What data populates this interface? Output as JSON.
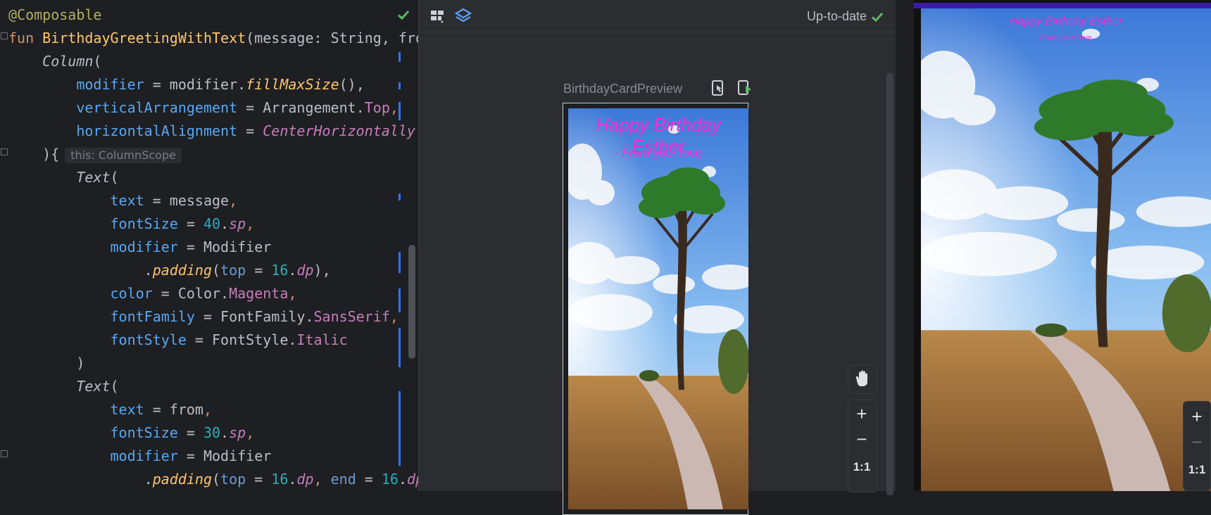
{
  "editor": {
    "hint_text": "this: ColumnScope",
    "lines": [
      [
        {
          "t": "@Composable",
          "c": "ann"
        }
      ],
      [
        {
          "t": "fun ",
          "c": "kw"
        },
        {
          "t": "BirthdayGreetingWithText",
          "c": "fn"
        },
        {
          "t": "(message: String, fro",
          "c": "id"
        }
      ],
      [
        {
          "t": "    ",
          "c": "id"
        },
        {
          "t": "Column",
          "c": "it"
        },
        {
          "t": "(",
          "c": "id"
        }
      ],
      [
        {
          "t": "        ",
          "c": "id"
        },
        {
          "t": "modifier",
          "c": "prm"
        },
        {
          "t": " = modifier.",
          "c": "id"
        },
        {
          "t": "fillMaxSize",
          "c": "ext"
        },
        {
          "t": "(),",
          "c": "id"
        }
      ],
      [
        {
          "t": "        ",
          "c": "id"
        },
        {
          "t": "verticalArrangement",
          "c": "prm"
        },
        {
          "t": " = Arrangement.",
          "c": "id"
        },
        {
          "t": "Top",
          "c": "prop"
        },
        {
          "t": ",",
          "c": "kw"
        }
      ],
      [
        {
          "t": "        ",
          "c": "id"
        },
        {
          "t": "horizontalAlignment",
          "c": "prm"
        },
        {
          "t": " = ",
          "c": "id"
        },
        {
          "t": "CenterHorizontally",
          "c": "propi"
        }
      ],
      [
        {
          "t": "    ){",
          "c": "id"
        },
        {
          "t": "HINT",
          "c": "hint"
        }
      ],
      [
        {
          "t": "        ",
          "c": "id"
        },
        {
          "t": "Text",
          "c": "it"
        },
        {
          "t": "(",
          "c": "id"
        }
      ],
      [
        {
          "t": "            ",
          "c": "id"
        },
        {
          "t": "text",
          "c": "prm"
        },
        {
          "t": " = message",
          "c": "id"
        },
        {
          "t": ",",
          "c": "kw"
        }
      ],
      [
        {
          "t": "            ",
          "c": "id"
        },
        {
          "t": "fontSize",
          "c": "prm"
        },
        {
          "t": " = ",
          "c": "id"
        },
        {
          "t": "40",
          "c": "num"
        },
        {
          "t": ".",
          "c": "id"
        },
        {
          "t": "sp",
          "c": "propi"
        },
        {
          "t": ",",
          "c": "kw"
        }
      ],
      [
        {
          "t": "            ",
          "c": "id"
        },
        {
          "t": "modifier",
          "c": "prm"
        },
        {
          "t": " = Modifier",
          "c": "id"
        }
      ],
      [
        {
          "t": "                .",
          "c": "id"
        },
        {
          "t": "padding",
          "c": "ext"
        },
        {
          "t": "(",
          "c": "id"
        },
        {
          "t": "top",
          "c": "prm2"
        },
        {
          "t": " = ",
          "c": "id"
        },
        {
          "t": "16",
          "c": "num"
        },
        {
          "t": ".",
          "c": "id"
        },
        {
          "t": "dp",
          "c": "propi"
        },
        {
          "t": "),",
          "c": "id"
        }
      ],
      [
        {
          "t": "            ",
          "c": "id"
        },
        {
          "t": "color",
          "c": "prm"
        },
        {
          "t": " = Color.",
          "c": "id"
        },
        {
          "t": "Magenta",
          "c": "prop"
        },
        {
          "t": ",",
          "c": "kw"
        }
      ],
      [
        {
          "t": "            ",
          "c": "id"
        },
        {
          "t": "fontFamily",
          "c": "prm"
        },
        {
          "t": " = FontFamily.",
          "c": "id"
        },
        {
          "t": "SansSerif",
          "c": "prop"
        },
        {
          "t": ",",
          "c": "kw"
        }
      ],
      [
        {
          "t": "            ",
          "c": "id"
        },
        {
          "t": "fontStyle",
          "c": "prm"
        },
        {
          "t": " = FontStyle.",
          "c": "id"
        },
        {
          "t": "Italic",
          "c": "prop"
        }
      ],
      [
        {
          "t": "        )",
          "c": "id"
        }
      ],
      [
        {
          "t": "        ",
          "c": "id"
        },
        {
          "t": "Text",
          "c": "it"
        },
        {
          "t": "(",
          "c": "id"
        }
      ],
      [
        {
          "t": "            ",
          "c": "id"
        },
        {
          "t": "text",
          "c": "prm"
        },
        {
          "t": " = from",
          "c": "id"
        },
        {
          "t": ",",
          "c": "kw"
        }
      ],
      [
        {
          "t": "            ",
          "c": "id"
        },
        {
          "t": "fontSize",
          "c": "prm"
        },
        {
          "t": " = ",
          "c": "id"
        },
        {
          "t": "30",
          "c": "num"
        },
        {
          "t": ".",
          "c": "id"
        },
        {
          "t": "sp",
          "c": "propi"
        },
        {
          "t": ",",
          "c": "kw"
        }
      ],
      [
        {
          "t": "            ",
          "c": "id"
        },
        {
          "t": "modifier",
          "c": "prm"
        },
        {
          "t": " = Modifier",
          "c": "id"
        }
      ],
      [
        {
          "t": "                .",
          "c": "id"
        },
        {
          "t": "padding",
          "c": "ext"
        },
        {
          "t": "(",
          "c": "id"
        },
        {
          "t": "top",
          "c": "prm2"
        },
        {
          "t": " = ",
          "c": "id"
        },
        {
          "t": "16",
          "c": "num"
        },
        {
          "t": ".",
          "c": "id"
        },
        {
          "t": "dp",
          "c": "propi"
        },
        {
          "t": ", ",
          "c": "kw"
        },
        {
          "t": "end",
          "c": "prm2"
        },
        {
          "t": " = ",
          "c": "id"
        },
        {
          "t": "16",
          "c": "num"
        },
        {
          "t": ".",
          "c": "id"
        },
        {
          "t": "dp",
          "c": "propi"
        }
      ]
    ]
  },
  "design": {
    "status_label": "Up-to-date",
    "preview_name": "BirthdayCardPreview",
    "zoom_in": "+",
    "zoom_out": "−",
    "zoom_reset": "1:1"
  },
  "card": {
    "greeting": "Happy Birthday Esther",
    "from": "- From your love"
  },
  "emulator": {
    "greeting": "Happy Birthday Esther",
    "from": "From your love",
    "zoom_in": "+",
    "zoom_out": "−",
    "zoom_reset": "1:1"
  },
  "colors": {
    "accent": "#3574f0",
    "success": "#5fb865",
    "magenta_text": "#ff2ad6"
  }
}
